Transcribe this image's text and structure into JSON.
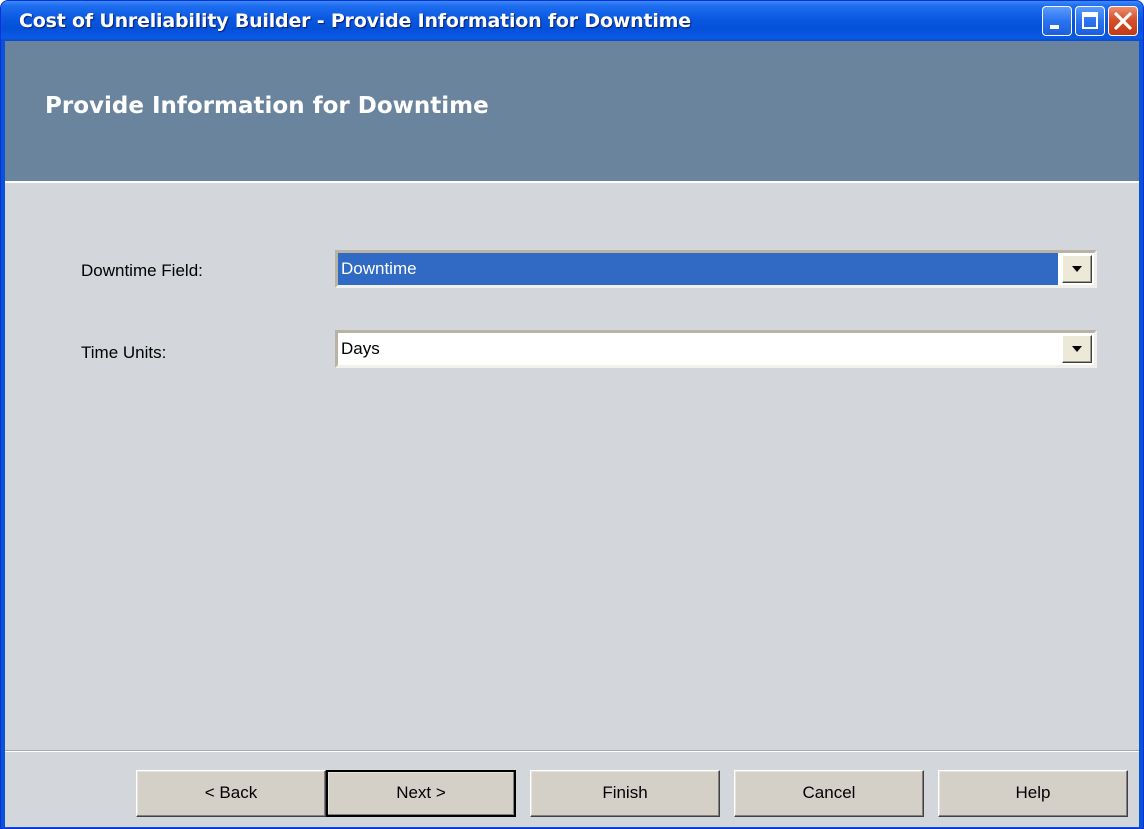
{
  "window": {
    "title": "Cost of Unreliability Builder - Provide Information for Downtime",
    "controls": {
      "minimize_icon": "minimize-icon",
      "maximize_icon": "maximize-icon",
      "close_icon": "close-icon"
    }
  },
  "header": {
    "title": "Provide Information for Downtime"
  },
  "form": {
    "downtime_field": {
      "label": "Downtime Field:",
      "value": "Downtime",
      "selected": true
    },
    "time_units": {
      "label": "Time Units:",
      "value": "Days"
    }
  },
  "buttons": {
    "back": "< Back",
    "next": "Next >",
    "finish": "Finish",
    "cancel": "Cancel",
    "help": "Help"
  },
  "colors": {
    "title_bar": "#0a58e0",
    "header_band": "#6a849e",
    "content_background": "#d3d6da",
    "selection": "#316ac5",
    "close_button": "#d6502c"
  }
}
